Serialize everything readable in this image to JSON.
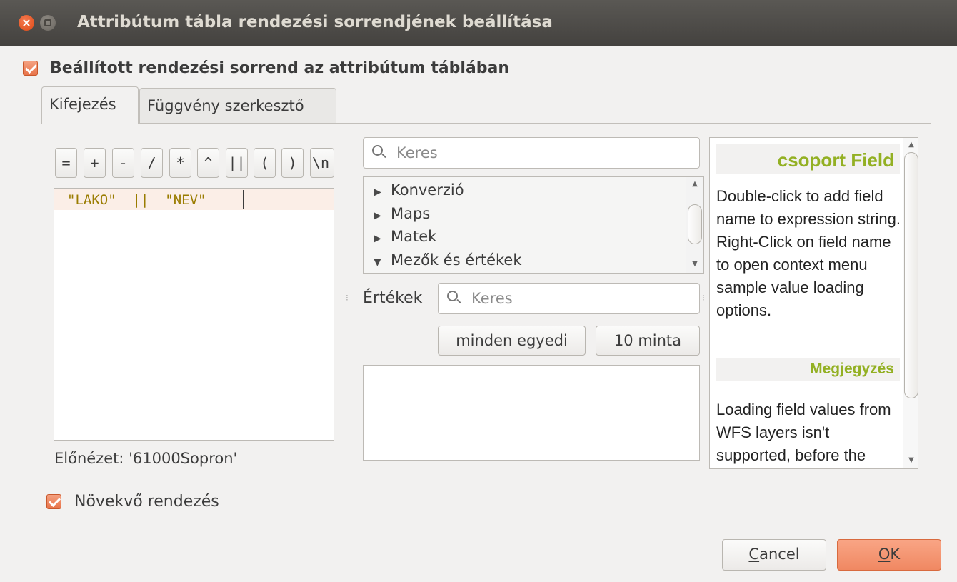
{
  "window": {
    "title": "Attribútum tábla rendezési sorrendjének beállítása"
  },
  "main_checkbox": {
    "label": "Beállított rendezési sorrend az attribútum táblában",
    "checked": true
  },
  "tabs": [
    {
      "label": "Kifejezés",
      "active": true
    },
    {
      "label": "Függvény szerkesztő",
      "active": false
    }
  ],
  "operators": [
    "=",
    "+",
    "-",
    "/",
    "*",
    "^",
    "||",
    "(",
    ")",
    "\\n"
  ],
  "expression": {
    "text": "\"LAKO\"  ||  \"NEV\"",
    "preview": "Előnézet: '61000Sopron'"
  },
  "function_search": {
    "placeholder": "Keres"
  },
  "function_tree": [
    {
      "label": "Konverzió",
      "expanded": false
    },
    {
      "label": "Maps",
      "expanded": false
    },
    {
      "label": "Matek",
      "expanded": false
    },
    {
      "label": "Mezők és értékek",
      "expanded": true
    }
  ],
  "values": {
    "label": "Értékek",
    "search_placeholder": "Keres",
    "all_unique_label": "minden egyedi",
    "sample_label": "10 minta"
  },
  "help": {
    "title": "csoport Field",
    "body": "Double-click to add field name to expression string. Right-Click on field name to open context menu sample value loading options.",
    "note_title": "Megjegyzés",
    "note_body": "Loading field values from WFS layers isn't supported, before the"
  },
  "ascending_checkbox": {
    "label": "Növekvő rendezés",
    "checked": true
  },
  "buttons": {
    "cancel_mnemonic": "C",
    "cancel_rest": "ancel",
    "ok_mnemonic": "O",
    "ok_rest": "K"
  },
  "colors": {
    "accent": "#e8744a",
    "help_heading": "#93b023",
    "expression_text": "#9a7c00",
    "titlebar": "#4b4946"
  }
}
